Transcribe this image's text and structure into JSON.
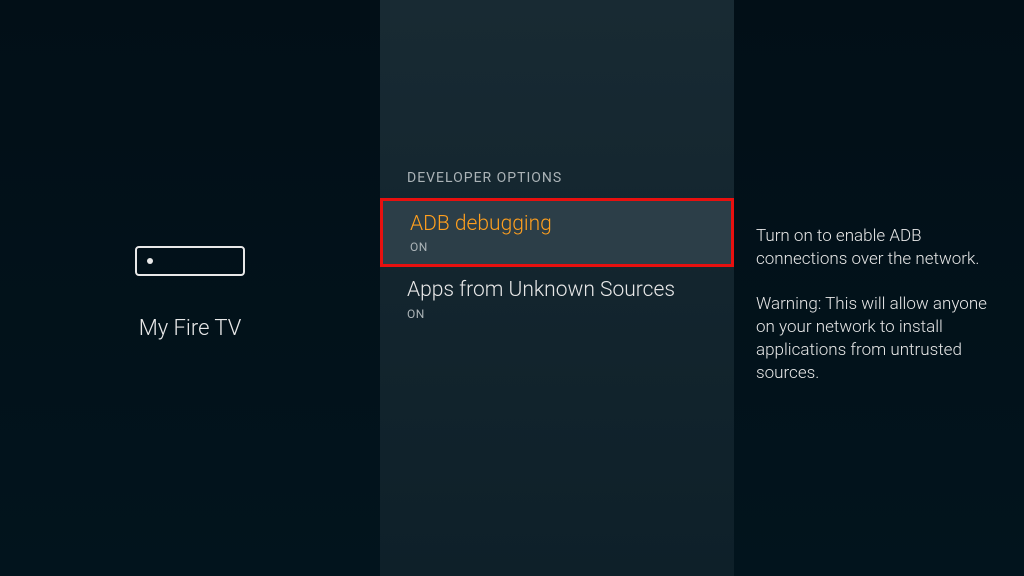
{
  "left": {
    "device_label": "My Fire TV"
  },
  "middle": {
    "section_title": "DEVELOPER OPTIONS",
    "options": [
      {
        "title": "ADB debugging",
        "status": "ON"
      },
      {
        "title": "Apps from Unknown Sources",
        "status": "ON"
      }
    ]
  },
  "right": {
    "paragraph1": "Turn on to enable ADB connections over the network.",
    "paragraph2": "Warning: This will allow anyone on your network to install applications from untrusted sources."
  }
}
